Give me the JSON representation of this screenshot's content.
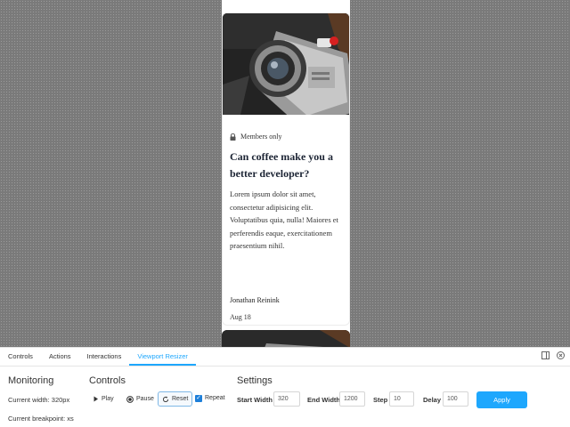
{
  "card": {
    "badge": "Members only",
    "title": "Can coffee make you a better developer?",
    "body": "Lorem ipsum dolor sit amet, consectetur adipisicing elit. Voluptatibus quia, nulla! Maiores et perferendis eaque, exercitationem praesentium nihil.",
    "author": "Jonathan Reinink",
    "date": "Aug 18"
  },
  "tabs": [
    {
      "label": "Controls",
      "active": false
    },
    {
      "label": "Actions",
      "active": false
    },
    {
      "label": "Interactions",
      "active": false
    },
    {
      "label": "Viewport Resizer",
      "active": true
    }
  ],
  "panel_icons": [
    "sidebar-toggle-icon",
    "close-icon"
  ],
  "monitoring": {
    "title": "Monitoring",
    "width_text": "Current width: 320px",
    "breakpoint_text": "Current breakpoint: xs"
  },
  "controls": {
    "title": "Controls",
    "play": "Play",
    "pause": "Pause",
    "reset": "Reset",
    "repeat": "Repeat",
    "repeat_checked": true
  },
  "settings": {
    "title": "Settings",
    "start_width_label": "Start Width",
    "start_width": "320",
    "end_width_label": "End Width",
    "end_width": "1200",
    "step_label": "Step",
    "step": "10",
    "delay_label": "Delay",
    "delay": "100",
    "apply": "Apply"
  },
  "colors": {
    "accent": "#1ea7fd",
    "title_text": "#1c2434"
  }
}
